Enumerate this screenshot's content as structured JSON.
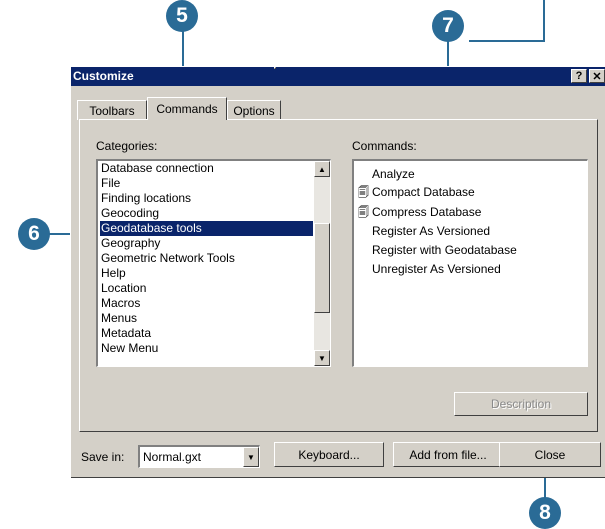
{
  "callouts": {
    "c5": "5",
    "c6": "6",
    "c7": "7",
    "c8": "8"
  },
  "dialog": {
    "title": "Customize",
    "help_button": "?",
    "close_button": "✕",
    "tabs": [
      {
        "label": "Toolbars"
      },
      {
        "label": "Commands"
      },
      {
        "label": "Options"
      }
    ],
    "active_tab": "Commands",
    "categories_label": "Categories:",
    "commands_label": "Commands:",
    "categories": [
      "Database connection",
      "File",
      "Finding locations",
      "Geocoding",
      "Geodatabase tools",
      "Geography",
      "Geometric Network Tools",
      "Help",
      "Location",
      "Macros",
      "Menus",
      "Metadata",
      "New Menu"
    ],
    "selected_category": "Geodatabase tools",
    "commands": [
      {
        "label": "Analyze",
        "icon": ""
      },
      {
        "label": "Compact Database",
        "icon": "database-icon"
      },
      {
        "label": "Compress Database",
        "icon": "database-icon"
      },
      {
        "label": "Register As Versioned",
        "icon": ""
      },
      {
        "label": "Register with Geodatabase",
        "icon": ""
      },
      {
        "label": "Unregister As Versioned",
        "icon": ""
      }
    ],
    "description_button": "Description",
    "save_in_label": "Save in:",
    "save_in_value": "Normal.gxt",
    "keyboard_button": "Keyboard...",
    "add_from_file_button": "Add from file...",
    "close_label": "Close"
  },
  "colors": {
    "callout": "#2a6b96",
    "titlebar": "#0a246a",
    "dialog_bg": "#d4d0c8"
  }
}
